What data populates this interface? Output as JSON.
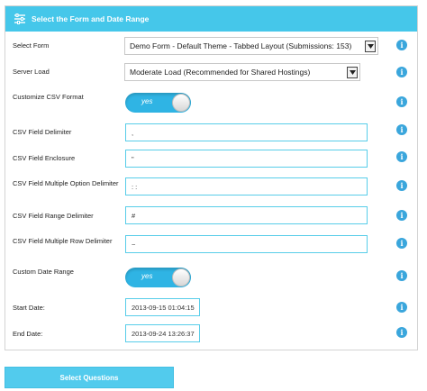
{
  "panel": {
    "title": "Select the Form and Date Range"
  },
  "fields": {
    "select_form": {
      "label": "Select Form",
      "value": "Demo Form - Default Theme - Tabbed Layout (Submissions: 153)"
    },
    "server_load": {
      "label": "Server Load",
      "value": "Moderate Load (Recommended for Shared Hostings)"
    },
    "customize_csv": {
      "label": "Customize CSV Format",
      "toggle": "yes"
    },
    "csv_delimiter": {
      "label": "CSV Field Delimiter",
      "value": ","
    },
    "csv_enclosure": {
      "label": "CSV Field Enclosure",
      "value": "\""
    },
    "csv_multi_option": {
      "label": "CSV Field Multiple Option Delimiter",
      "value": ": :"
    },
    "csv_range": {
      "label": "CSV Field Range Delimiter",
      "value": "#"
    },
    "csv_multi_row": {
      "label": "CSV Field Multiple Row Delimiter",
      "value": "~"
    },
    "custom_date": {
      "label": "Custom Date Range",
      "toggle": "yes"
    },
    "start_date": {
      "label": "Start Date:",
      "value": "2013-09-15 01:04:15"
    },
    "end_date": {
      "label": "End Date:",
      "value": "2013-09-24 13:26:37"
    }
  },
  "info_icon": "i",
  "button": {
    "label": "Select Questions"
  },
  "colors": {
    "header": "#45c7ea",
    "accent": "#2fb4e4",
    "info": "#3aa6dc",
    "button": "#52cbed"
  }
}
